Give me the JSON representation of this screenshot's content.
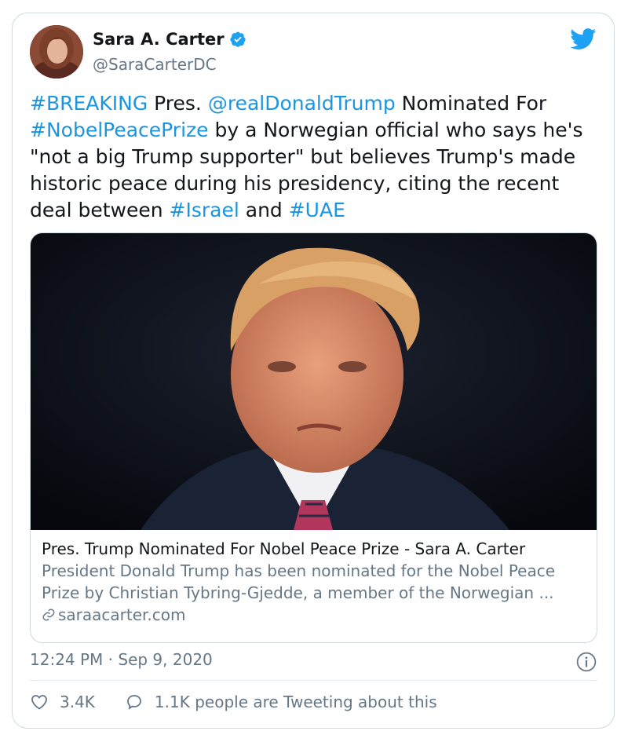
{
  "tweet": {
    "author_name": "Sara A. Carter",
    "author_handle": "@SaraCarterDC",
    "text_parts": [
      {
        "text": "#BREAKING",
        "link": true
      },
      {
        "text": " Pres. ",
        "link": false
      },
      {
        "text": "@realDonaldTrump",
        "link": true
      },
      {
        "text": " Nominated For ",
        "link": false
      },
      {
        "text": "#NobelPeacePrize",
        "link": true
      },
      {
        "text": " by a Norwegian official who says he's \"not a big Trump supporter\" but believes Trump's made historic peace during his presidency, citing the recent deal between ",
        "link": false
      },
      {
        "text": "#Israel",
        "link": true
      },
      {
        "text": " and ",
        "link": false
      },
      {
        "text": "#UAE",
        "link": true
      }
    ],
    "timestamp": "12:24 PM · Sep 9, 2020"
  },
  "link_card": {
    "title": "Pres. Trump Nominated For Nobel Peace Prize - Sara A. Carter",
    "description_line1": "President Donald Trump has been nominated for the Nobel Peace",
    "description_line2": "Prize by Christian Tybring-Gjedde, a member of the Norwegian ...",
    "domain": "saraacarter.com"
  },
  "actions": {
    "likes": "3.4K",
    "tweeting": "1.1K people are Tweeting about this"
  },
  "icons": {
    "bird": "twitter-bird-icon",
    "verified": "verified-badge-icon",
    "like": "heart-icon",
    "reply": "speech-bubble-icon",
    "info": "info-icon",
    "link": "chain-link-icon"
  },
  "colors": {
    "link": "#1b95e0",
    "text": "#14171a",
    "muted": "#657786",
    "border": "#cfd9de"
  }
}
